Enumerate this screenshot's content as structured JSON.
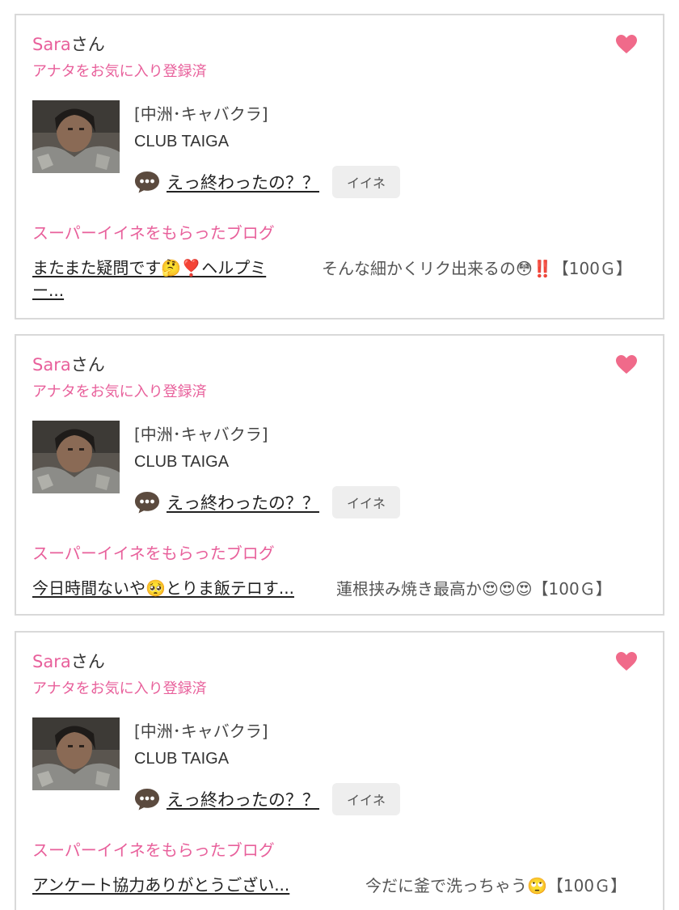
{
  "cards": [
    {
      "user_name": "Sara",
      "user_suffix": "さん",
      "fav_status": "アナタをお気に入り登録済",
      "shop_area": "[中洲･キャバクラ]",
      "shop_name": "CLUB TAIGA",
      "message": "えっ終わったの？？",
      "like_label": "イイネ",
      "section_title": "スーパーイイネをもらったブログ",
      "blog_title": "またまた疑問です🤔❣️ヘルプミー...",
      "blog_comment": "そんな細かくリク出来るの😳‼️【100Ｇ】"
    },
    {
      "user_name": "Sara",
      "user_suffix": "さん",
      "fav_status": "アナタをお気に入り登録済",
      "shop_area": "[中洲･キャバクラ]",
      "shop_name": "CLUB TAIGA",
      "message": "えっ終わったの？？",
      "like_label": "イイネ",
      "section_title": "スーパーイイネをもらったブログ",
      "blog_title": "今日時間ないや🥺とりま飯テロす...",
      "blog_comment": "蓮根挟み焼き最高か😍😍😍【100Ｇ】"
    },
    {
      "user_name": "Sara",
      "user_suffix": "さん",
      "fav_status": "アナタをお気に入り登録済",
      "shop_area": "[中洲･キャバクラ]",
      "shop_name": "CLUB TAIGA",
      "message": "えっ終わったの？？",
      "like_label": "イイネ",
      "section_title": "スーパーイイネをもらったブログ",
      "blog_title": "アンケート協力ありがとうござい...",
      "blog_comment": "今だに釜で洗っちゃう🙄【100Ｇ】"
    }
  ],
  "colors": {
    "accent": "#e8609b",
    "heart": "#f06a8a",
    "border": "#d9d9d9",
    "button_bg": "#eeeeee"
  },
  "icons": {
    "favorite": "heart-icon",
    "message": "chat-bubble-icon"
  }
}
